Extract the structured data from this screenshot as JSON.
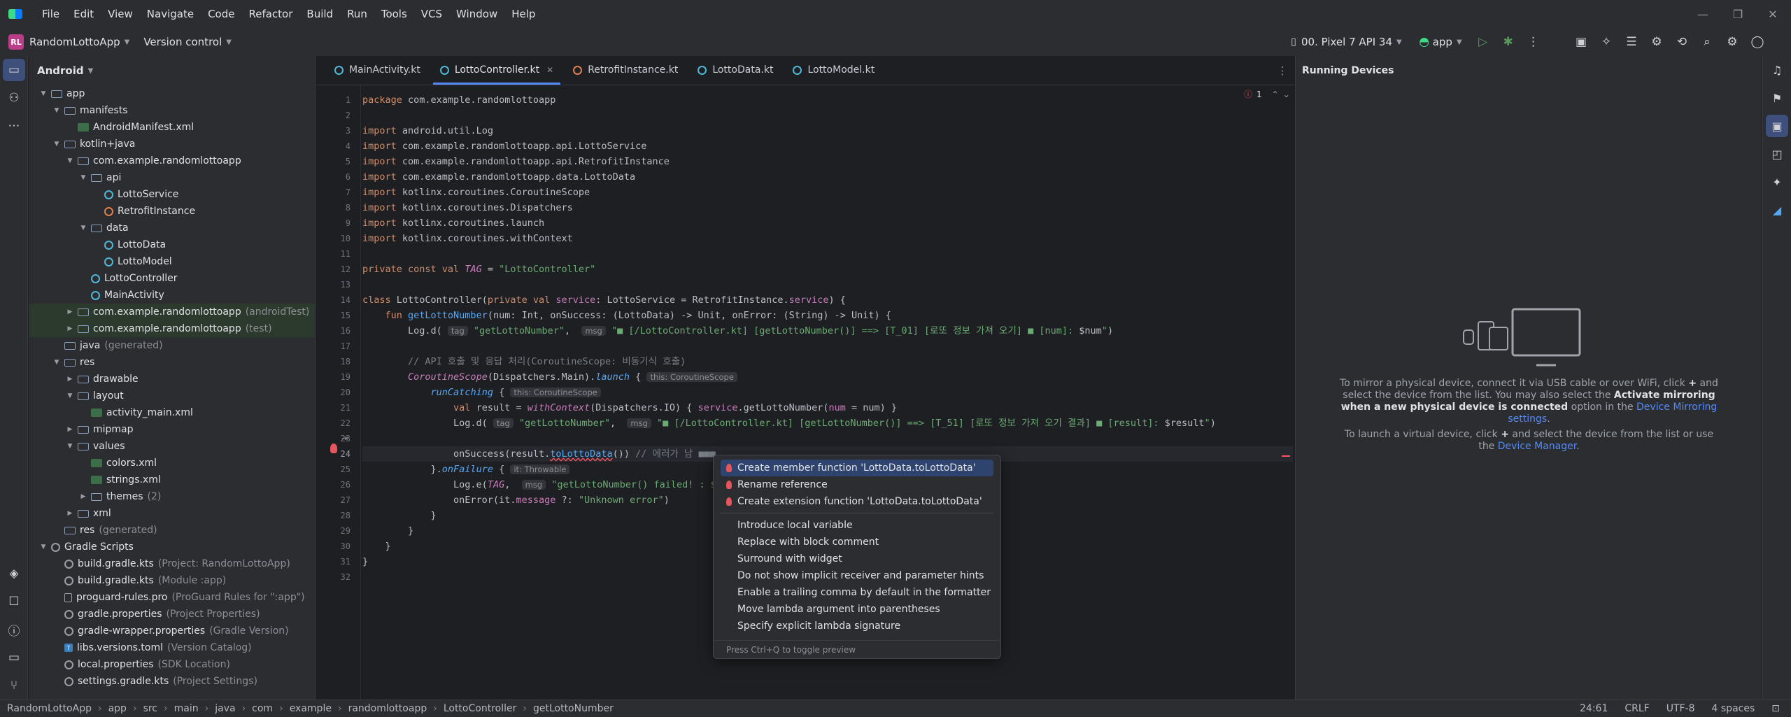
{
  "menubar": {
    "items": [
      "File",
      "Edit",
      "View",
      "Navigate",
      "Code",
      "Refactor",
      "Build",
      "Run",
      "Tools",
      "VCS",
      "Window",
      "Help"
    ]
  },
  "toolbar": {
    "project_initials": "RL",
    "project_name": "RandomLottoApp",
    "vcs_label": "Version control",
    "device": "00. Pixel 7 API 34",
    "run_config": "app"
  },
  "project_panel": {
    "header": "Android",
    "tree": [
      {
        "label": "app",
        "depth": 0,
        "icon": "folder",
        "arrow": "open"
      },
      {
        "label": "manifests",
        "depth": 1,
        "icon": "folder",
        "arrow": "open"
      },
      {
        "label": "AndroidManifest.xml",
        "depth": 2,
        "icon": "xml",
        "arrow": ""
      },
      {
        "label": "kotlin+java",
        "depth": 1,
        "icon": "folder",
        "arrow": "open"
      },
      {
        "label": "com.example.randomlottoapp",
        "depth": 2,
        "icon": "folder",
        "arrow": "open"
      },
      {
        "label": "api",
        "depth": 3,
        "icon": "folder",
        "arrow": "open"
      },
      {
        "label": "LottoService",
        "depth": 4,
        "icon": "kclass",
        "arrow": ""
      },
      {
        "label": "RetrofitInstance",
        "depth": 4,
        "icon": "kobj",
        "arrow": ""
      },
      {
        "label": "data",
        "depth": 3,
        "icon": "folder",
        "arrow": "open"
      },
      {
        "label": "LottoData",
        "depth": 4,
        "icon": "kclass",
        "arrow": ""
      },
      {
        "label": "LottoModel",
        "depth": 4,
        "icon": "kclass",
        "arrow": ""
      },
      {
        "label": "LottoController",
        "depth": 3,
        "icon": "kclass",
        "arrow": ""
      },
      {
        "label": "MainActivity",
        "depth": 3,
        "icon": "kclass",
        "arrow": ""
      },
      {
        "label": "com.example.randomlottoapp",
        "dim": "(androidTest)",
        "depth": 2,
        "icon": "folder",
        "arrow": "closed",
        "bg": "green"
      },
      {
        "label": "com.example.randomlottoapp",
        "dim": "(test)",
        "depth": 2,
        "icon": "folder",
        "arrow": "closed",
        "bg": "green"
      },
      {
        "label": "java",
        "dim": "(generated)",
        "depth": 1,
        "icon": "folder",
        "arrow": ""
      },
      {
        "label": "res",
        "depth": 1,
        "icon": "folder",
        "arrow": "open"
      },
      {
        "label": "drawable",
        "depth": 2,
        "icon": "folder",
        "arrow": "closed"
      },
      {
        "label": "layout",
        "depth": 2,
        "icon": "folder",
        "arrow": "open"
      },
      {
        "label": "activity_main.xml",
        "depth": 3,
        "icon": "xml",
        "arrow": ""
      },
      {
        "label": "mipmap",
        "depth": 2,
        "icon": "folder",
        "arrow": "closed"
      },
      {
        "label": "values",
        "depth": 2,
        "icon": "folder",
        "arrow": "open"
      },
      {
        "label": "colors.xml",
        "depth": 3,
        "icon": "xml",
        "arrow": ""
      },
      {
        "label": "strings.xml",
        "depth": 3,
        "icon": "xml",
        "arrow": ""
      },
      {
        "label": "themes",
        "dim": "(2)",
        "depth": 3,
        "icon": "folder",
        "arrow": "closed"
      },
      {
        "label": "xml",
        "depth": 2,
        "icon": "folder",
        "arrow": "closed"
      },
      {
        "label": "res",
        "dim": "(generated)",
        "depth": 1,
        "icon": "folder",
        "arrow": ""
      },
      {
        "label": "Gradle Scripts",
        "depth": 0,
        "icon": "gradle",
        "arrow": "open"
      },
      {
        "label": "build.gradle.kts",
        "dim": "(Project: RandomLottoApp)",
        "depth": 1,
        "icon": "gradle",
        "arrow": ""
      },
      {
        "label": "build.gradle.kts",
        "dim": "(Module :app)",
        "depth": 1,
        "icon": "gradle",
        "arrow": ""
      },
      {
        "label": "proguard-rules.pro",
        "dim": "(ProGuard Rules for \":app\")",
        "depth": 1,
        "icon": "file",
        "arrow": ""
      },
      {
        "label": "gradle.properties",
        "dim": "(Project Properties)",
        "depth": 1,
        "icon": "gradle",
        "arrow": ""
      },
      {
        "label": "gradle-wrapper.properties",
        "dim": "(Gradle Version)",
        "depth": 1,
        "icon": "gradle",
        "arrow": ""
      },
      {
        "label": "libs.versions.toml",
        "dim": "(Version Catalog)",
        "depth": 1,
        "icon": "toml",
        "arrow": ""
      },
      {
        "label": "local.properties",
        "dim": "(SDK Location)",
        "depth": 1,
        "icon": "gradle",
        "arrow": ""
      },
      {
        "label": "settings.gradle.kts",
        "dim": "(Project Settings)",
        "depth": 1,
        "icon": "gradle",
        "arrow": ""
      }
    ]
  },
  "tabs": [
    {
      "label": "MainActivity.kt",
      "icon": "kclass"
    },
    {
      "label": "LottoController.kt",
      "icon": "kclass",
      "active": true
    },
    {
      "label": "RetrofitInstance.kt",
      "icon": "kobj"
    },
    {
      "label": "LottoData.kt",
      "icon": "kclass"
    },
    {
      "label": "LottoModel.kt",
      "icon": "kclass"
    }
  ],
  "editor": {
    "problem_count": "1",
    "current_line": 24,
    "lines": [
      [
        [
          "kw",
          "package "
        ],
        [
          "",
          "com.example.randomlottoapp"
        ]
      ],
      [],
      [
        [
          "kw",
          "import "
        ],
        [
          "",
          "android.util.Log"
        ]
      ],
      [
        [
          "kw",
          "import "
        ],
        [
          "",
          "com.example.randomlottoapp.api.LottoService"
        ]
      ],
      [
        [
          "kw",
          "import "
        ],
        [
          "",
          "com.example.randomlottoapp.api.RetrofitInstance"
        ]
      ],
      [
        [
          "kw",
          "import "
        ],
        [
          "",
          "com.example.randomlottoapp.data.LottoData"
        ]
      ],
      [
        [
          "kw",
          "import "
        ],
        [
          "",
          "kotlinx.coroutines.CoroutineScope"
        ]
      ],
      [
        [
          "kw",
          "import "
        ],
        [
          "",
          "kotlinx.coroutines.Dispatchers"
        ]
      ],
      [
        [
          "kw",
          "import "
        ],
        [
          "",
          "kotlinx.coroutines.launch"
        ]
      ],
      [
        [
          "kw",
          "import "
        ],
        [
          "",
          "kotlinx.coroutines.withContext"
        ]
      ],
      [],
      [
        [
          "kw",
          "private const val "
        ],
        [
          "it",
          "TAG"
        ],
        [
          "",
          " = "
        ],
        [
          "str",
          "\"LottoController\""
        ]
      ],
      [],
      [
        [
          "kw",
          "class "
        ],
        [
          "",
          "LottoController("
        ],
        [
          "kw",
          "private val "
        ],
        [
          "prop",
          "service"
        ],
        [
          "",
          ": LottoService = RetrofitInstance."
        ],
        [
          "prop",
          "service"
        ],
        [
          "",
          ") {"
        ]
      ],
      [
        [
          "",
          "    "
        ],
        [
          "kw",
          "fun "
        ],
        [
          "fn",
          "getLottoNumber"
        ],
        [
          "",
          "(num: Int, onSuccess: (LottoData) -> Unit, onError: (String) -> Unit) {"
        ]
      ],
      [
        [
          "",
          "        Log.d( "
        ],
        [
          "hint",
          "tag"
        ],
        [
          "",
          ""
        ],
        [
          "str",
          " \"getLottoNumber\""
        ],
        [
          "",
          ",  "
        ],
        [
          "hint",
          "msg"
        ],
        [
          "str",
          " \"■ [/LottoController.kt] [getLottoNumber()] ==> [T_01] [로또 정보 가져 오기] ■ [num]: "
        ],
        [
          "",
          "$num"
        ],
        [
          "str",
          "\""
        ],
        [
          "",
          ")"
        ]
      ],
      [],
      [
        [
          "",
          "        "
        ],
        [
          "cmt",
          "// API 호출 및 응답 처리(CoroutineScope: 비동기식 호출)"
        ]
      ],
      [
        [
          "",
          "        "
        ],
        [
          "it",
          "CoroutineScope"
        ],
        [
          "",
          "(Dispatchers.Main)."
        ],
        [
          "ext",
          "launch"
        ],
        [
          "",
          " { "
        ],
        [
          "hint",
          "this: CoroutineScope"
        ]
      ],
      [
        [
          "",
          "            "
        ],
        [
          "ext",
          "runCatching"
        ],
        [
          "",
          " { "
        ],
        [
          "hint",
          "this: CoroutineScope"
        ]
      ],
      [
        [
          "",
          "                "
        ],
        [
          "kw",
          "val "
        ],
        [
          "",
          "result = "
        ],
        [
          "it",
          "withContext"
        ],
        [
          "",
          "(Dispatchers.IO) { "
        ],
        [
          "prop",
          "service"
        ],
        [
          "",
          ".getLottoNumber("
        ],
        [
          "prop",
          "num"
        ],
        [
          "",
          " = num) }"
        ]
      ],
      [
        [
          "",
          "                Log.d( "
        ],
        [
          "hint",
          "tag"
        ],
        [
          "str",
          " \"getLottoNumber\""
        ],
        [
          "",
          ",  "
        ],
        [
          "hint",
          "msg"
        ],
        [
          "str",
          " \"■ [/LottoController.kt] [getLottoNumber()] ==> [T_51] [로또 정보 가져 오기 결과] ■ [result]: "
        ],
        [
          "",
          "$result"
        ],
        [
          "str",
          "\""
        ],
        [
          "",
          ")"
        ]
      ],
      [],
      [
        [
          "",
          "                onSuccess(result."
        ],
        [
          "err",
          "toLottoData"
        ],
        [
          "",
          "()) "
        ],
        [
          "cmt",
          "// 에러가 남 ■■■"
        ]
      ],
      [
        [
          "",
          "            }."
        ],
        [
          "ext",
          "onFailure"
        ],
        [
          "",
          " { "
        ],
        [
          "hint",
          "it: Throwable"
        ]
      ],
      [
        [
          "",
          "                Log.e("
        ],
        [
          "it",
          "TAG"
        ],
        [
          "",
          ",  "
        ],
        [
          "hint",
          "msg"
        ],
        [
          "str",
          " \"getLottoNumber() failed! : ${"
        ]
      ],
      [
        [
          "",
          "                onError(it."
        ],
        [
          "prop",
          "message"
        ],
        [
          "",
          " ?: "
        ],
        [
          "str",
          "\"Unknown error\""
        ],
        [
          "",
          ")"
        ]
      ],
      [
        [
          "",
          "            }"
        ]
      ],
      [
        [
          "",
          "        }"
        ]
      ],
      [
        [
          "",
          "    }"
        ]
      ],
      [
        [
          "",
          "}"
        ]
      ],
      []
    ]
  },
  "popup": {
    "items": [
      {
        "label": "Create member function 'LottoData.toLottoData'",
        "bulb": true,
        "selected": true
      },
      {
        "label": "Rename reference",
        "bulb": true
      },
      {
        "label": "Create extension function 'LottoData.toLottoData'",
        "bulb": true
      },
      {
        "sep": true
      },
      {
        "label": "Introduce local variable"
      },
      {
        "label": "Replace with block comment"
      },
      {
        "label": "Surround with widget"
      },
      {
        "label": "Do not show implicit receiver and parameter hints"
      },
      {
        "label": "Enable a trailing comma by default in the formatter"
      },
      {
        "label": "Move lambda argument into parentheses"
      },
      {
        "label": "Specify explicit lambda signature"
      }
    ],
    "footer": "Press Ctrl+Q to toggle preview"
  },
  "devices": {
    "title": "Running Devices",
    "msg1_a": "To mirror a physical device, connect it via USB cable or over WiFi, click",
    "msg1_b": "+",
    "msg1_c": "and select the device from the list. You may also select the",
    "msg1_bold": "Activate mirroring when a new physical device is connected",
    "msg1_d": "option in the",
    "msg1_link": "Device Mirroring settings",
    "msg1_end": ".",
    "msg2_a": "To launch a virtual device, click",
    "msg2_b": "+",
    "msg2_c": "and select the device from the list or use the",
    "msg2_link": "Device Manager",
    "msg2_end": "."
  },
  "statusbar": {
    "breadcrumb": [
      "RandomLottoApp",
      "app",
      "src",
      "main",
      "java",
      "com",
      "example",
      "randomlottoapp",
      "LottoController",
      "getLottoNumber"
    ],
    "position": "24:61",
    "line_sep": "CRLF",
    "encoding": "UTF-8",
    "indent": "4 spaces"
  }
}
